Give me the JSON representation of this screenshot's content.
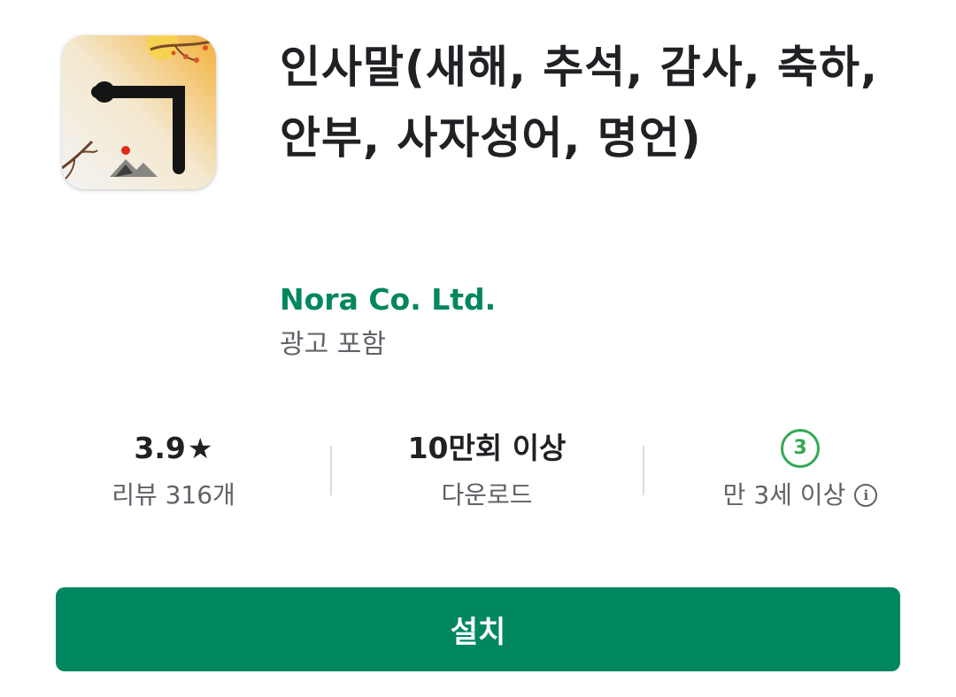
{
  "app": {
    "title": "인사말(새해, 추석, 감사, 축하, 안부, 사자성어, 명언)",
    "developer": "Nora Co. Ltd.",
    "ads_note": "광고 포함",
    "icon": "app-icon-hangul-giyeok"
  },
  "stats": {
    "rating": {
      "value": "3.9",
      "icon": "star-icon",
      "sub": "리뷰 316개"
    },
    "downloads": {
      "value": "10만회 이상",
      "sub": "다운로드"
    },
    "content_rating": {
      "badge": "3",
      "sub": "만 3세 이상",
      "icon": "info-icon"
    }
  },
  "install": {
    "label": "설치"
  },
  "colors": {
    "accent": "#01875f",
    "age_badge": "#34a853",
    "secondary_text": "#5f6368",
    "primary_text": "#202124"
  }
}
